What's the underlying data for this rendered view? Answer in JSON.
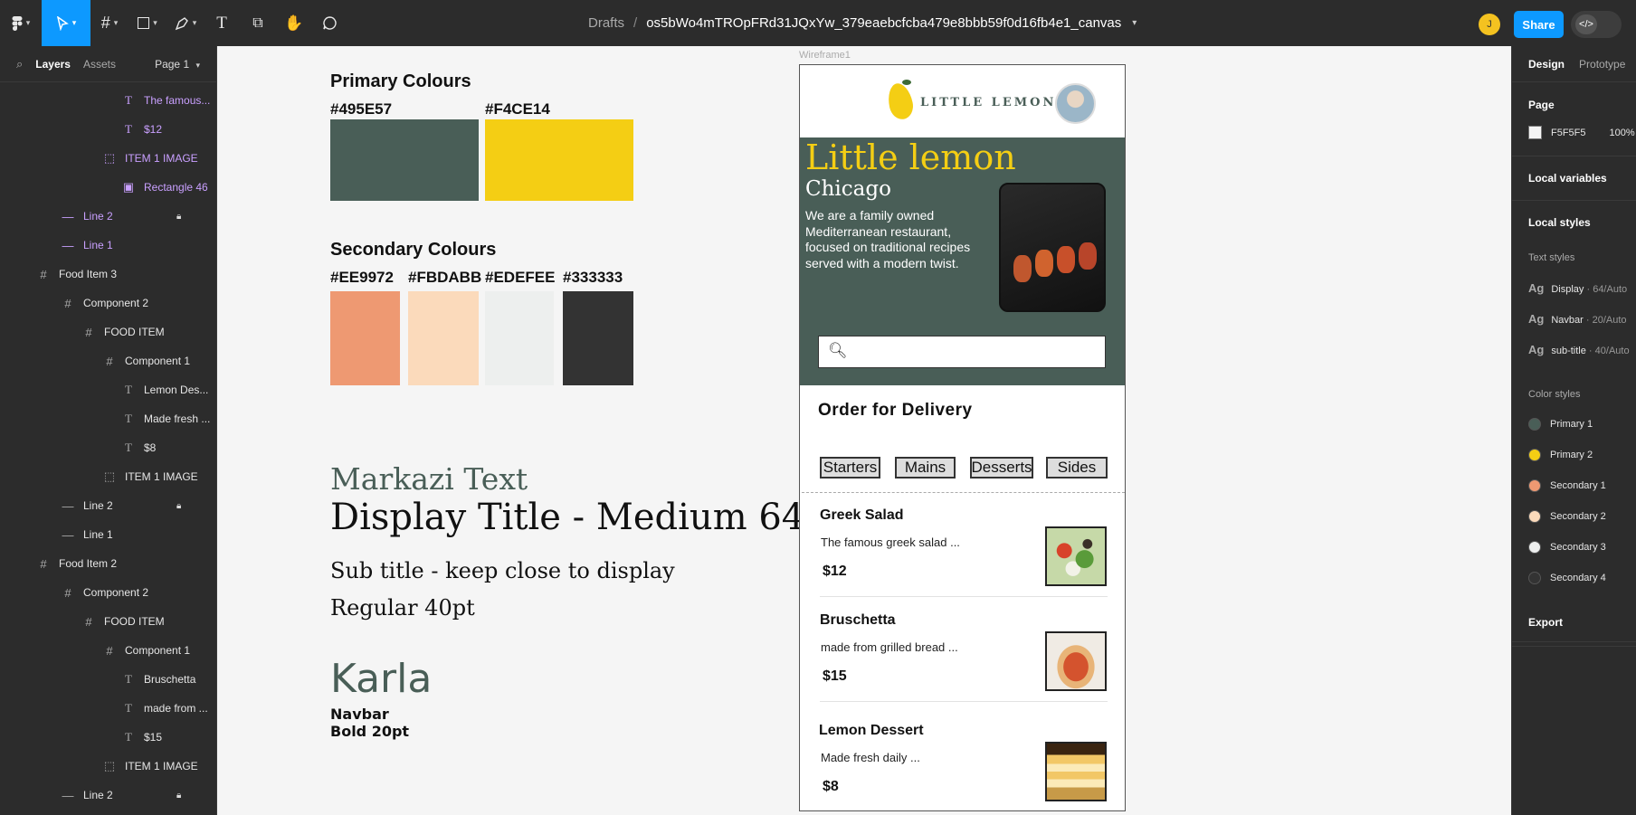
{
  "topbar": {
    "breadcrumb_drafts": "Drafts",
    "breadcrumb_sep": "/",
    "file_name": "os5bWo4mTROpFRd31JQxYw_379eaebcfcba479e8bbb59f0d16fb4e1_canvas",
    "avatar_initial": "J",
    "share_label": "Share",
    "dev_mode_icon": "</>"
  },
  "left_panel": {
    "tab_layers": "Layers",
    "tab_assets": "Assets",
    "page_label": "Page 1",
    "layers": [
      {
        "label": "The famous...",
        "kind": "text"
      },
      {
        "label": "$12",
        "kind": "text"
      },
      {
        "label": "ITEM 1 IMAGE",
        "kind": "frame-dashed"
      },
      {
        "label": "Rectangle 46",
        "kind": "image"
      },
      {
        "label": "Line 2",
        "kind": "line",
        "locked": true
      },
      {
        "label": "Line 1",
        "kind": "line"
      },
      {
        "label": "Food Item 3",
        "kind": "frame"
      },
      {
        "label": "Component 2",
        "kind": "frame"
      },
      {
        "label": "FOOD ITEM",
        "kind": "frame"
      },
      {
        "label": "Component 1",
        "kind": "frame"
      },
      {
        "label": "Lemon Des...",
        "kind": "text"
      },
      {
        "label": "Made fresh ...",
        "kind": "text"
      },
      {
        "label": "$8",
        "kind": "text"
      },
      {
        "label": "ITEM 1 IMAGE",
        "kind": "frame-dashed"
      },
      {
        "label": "Line 2",
        "kind": "line",
        "locked": true
      },
      {
        "label": "Line 1",
        "kind": "line"
      },
      {
        "label": "Food Item 2",
        "kind": "frame"
      },
      {
        "label": "Component 2",
        "kind": "frame"
      },
      {
        "label": "FOOD ITEM",
        "kind": "frame"
      },
      {
        "label": "Component 1",
        "kind": "frame"
      },
      {
        "label": "Bruschetta",
        "kind": "text"
      },
      {
        "label": "made from ...",
        "kind": "text"
      },
      {
        "label": "$15",
        "kind": "text"
      },
      {
        "label": "ITEM 1 IMAGE",
        "kind": "frame-dashed"
      },
      {
        "label": "Line 2",
        "kind": "line",
        "locked": true
      }
    ]
  },
  "right_panel": {
    "tab_design": "Design",
    "tab_prototype": "Prototype",
    "page_heading": "Page",
    "page_color": "F5F5F5",
    "page_opacity": "100%",
    "local_variables": "Local variables",
    "local_styles": "Local styles",
    "text_styles_heading": "Text styles",
    "text_styles": [
      {
        "icon": "Ag",
        "name": "Display",
        "meta": " · 64/Auto"
      },
      {
        "icon": "Ag",
        "name": "Navbar",
        "meta": " · 20/Auto"
      },
      {
        "icon": "Ag",
        "name": "sub-title",
        "meta": " · 40/Auto"
      }
    ],
    "color_styles_heading": "Color styles",
    "color_styles": [
      {
        "name": "Primary 1",
        "color": "#495E57"
      },
      {
        "name": "Primary 2",
        "color": "#F4CE14"
      },
      {
        "name": "Secondary 1",
        "color": "#EE9972"
      },
      {
        "name": "Secondary 2",
        "color": "#FBDABB"
      },
      {
        "name": "Secondary 3",
        "color": "#EDEFEE"
      },
      {
        "name": "Secondary 4",
        "color": "#333333"
      }
    ],
    "export_label": "Export"
  },
  "canvas": {
    "primary_heading": "Primary Colours",
    "primary_colors": [
      "#495E57",
      "#F4CE14"
    ],
    "secondary_heading": "Secondary Colours",
    "secondary_colors": [
      "#EE9972",
      "#FBDABB",
      "#EDEFEE",
      "#333333"
    ],
    "font1_name": "Markazi Text",
    "font1_display": "Display Title - Medium 64pt",
    "font1_sub_line1": "Sub title - keep close to display",
    "font1_sub_line2": "Regular 40pt",
    "font2_name": "Karla",
    "font2_line1": "Navbar",
    "font2_line2": "Bold 20pt"
  },
  "wireframe": {
    "frame_label": "Wireframe1",
    "logo_text": "LITTLE LEMON",
    "hero_title": "Little lemon",
    "hero_city": "Chicago",
    "hero_desc": "We are a family owned Mediterranean restaurant, focused on traditional recipes served with a modern twist.",
    "search_placeholder": "",
    "order_heading": "Order for Delivery",
    "tabs": [
      "Starters",
      "Mains",
      "Desserts",
      "Sides"
    ],
    "items": [
      {
        "name": "Greek Salad",
        "desc": "The famous greek salad ...",
        "price": "$12"
      },
      {
        "name": "Bruschetta",
        "desc": "made from grilled bread ...",
        "price": "$15"
      },
      {
        "name": "Lemon Dessert",
        "desc": "Made fresh daily ...",
        "price": "$8"
      }
    ]
  },
  "icons": {
    "main_menu": "figma-logo-icon",
    "move": "move-tool-icon",
    "frame": "frame-tool-icon",
    "shape": "rectangle-tool-icon",
    "pen": "pen-tool-icon",
    "text": "text-tool-icon",
    "resources": "resources-icon",
    "hand": "hand-tool-icon",
    "comment": "comment-icon"
  }
}
